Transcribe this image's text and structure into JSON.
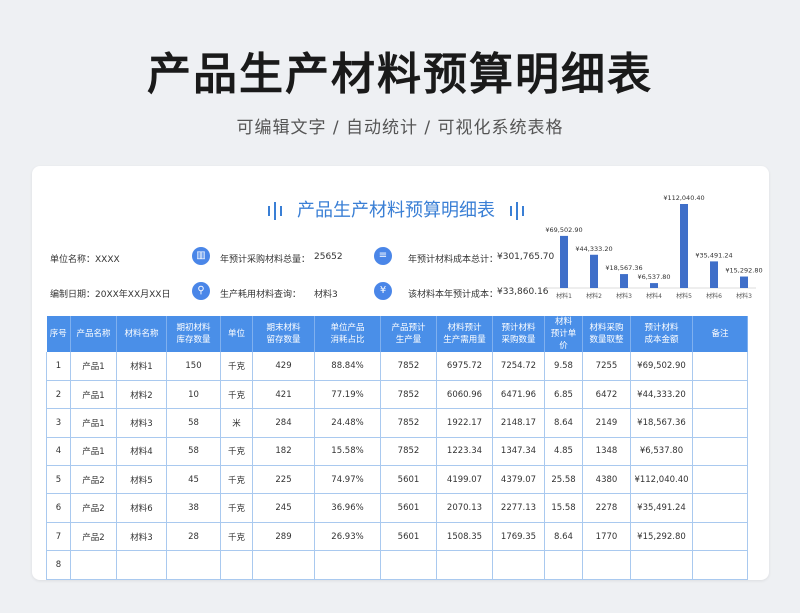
{
  "page": {
    "title": "产品生产材料预算明细表",
    "subtitle": "可编辑文字 / 自动统计 / 可视化系统表格"
  },
  "sheet": {
    "title": "产品生产材料预算明细表",
    "info": {
      "unit_label": "单位名称：XXXX",
      "date_label": "编制日期：20XX年XX月XX日",
      "total_purchase_label": "年预计采购材料总量：",
      "total_purchase_value": "25652",
      "total_cost_label": "年预计材料成本总计：",
      "total_cost_value": "¥301,765.70",
      "query_label": "生产耗用材料查询：",
      "query_value": "材料3",
      "material_cost_label": "该材料本年预计成本：",
      "material_cost_value": "¥33,860.16"
    },
    "headers": [
      [
        "序号"
      ],
      [
        "产品名称"
      ],
      [
        "材料名称"
      ],
      [
        "期初材料",
        "库存数量"
      ],
      [
        "单位"
      ],
      [
        "期末材料",
        "留存数量"
      ],
      [
        "单位产品",
        "消耗占比"
      ],
      [
        "产品预计",
        "生产量"
      ],
      [
        "材料预计",
        "生产需用量"
      ],
      [
        "预计材料",
        "采购数量"
      ],
      [
        "材料",
        "预计单价"
      ],
      [
        "材料采购",
        "数量取整"
      ],
      [
        "预计材料",
        "成本金额"
      ],
      [
        "备注"
      ]
    ],
    "rows": [
      [
        "1",
        "产品1",
        "材料1",
        "150",
        "千克",
        "429",
        "88.84%",
        "7852",
        "6975.72",
        "7254.72",
        "9.58",
        "7255",
        "¥69,502.90",
        ""
      ],
      [
        "2",
        "产品1",
        "材料2",
        "10",
        "千克",
        "421",
        "77.19%",
        "7852",
        "6060.96",
        "6471.96",
        "6.85",
        "6472",
        "¥44,333.20",
        ""
      ],
      [
        "3",
        "产品1",
        "材料3",
        "58",
        "米",
        "284",
        "24.48%",
        "7852",
        "1922.17",
        "2148.17",
        "8.64",
        "2149",
        "¥18,567.36",
        ""
      ],
      [
        "4",
        "产品1",
        "材料4",
        "58",
        "千克",
        "182",
        "15.58%",
        "7852",
        "1223.34",
        "1347.34",
        "4.85",
        "1348",
        "¥6,537.80",
        ""
      ],
      [
        "5",
        "产品2",
        "材料5",
        "45",
        "千克",
        "225",
        "74.97%",
        "5601",
        "4199.07",
        "4379.07",
        "25.58",
        "4380",
        "¥112,040.40",
        ""
      ],
      [
        "6",
        "产品2",
        "材料6",
        "38",
        "千克",
        "245",
        "36.96%",
        "5601",
        "2070.13",
        "2277.13",
        "15.58",
        "2278",
        "¥35,491.24",
        ""
      ],
      [
        "7",
        "产品2",
        "材料3",
        "28",
        "千克",
        "289",
        "26.93%",
        "5601",
        "1508.35",
        "1769.35",
        "8.64",
        "1770",
        "¥15,292.80",
        ""
      ],
      [
        "8",
        "",
        "",
        "",
        "",
        "",
        "",
        "",
        "",
        "",
        "",
        "",
        "",
        ""
      ]
    ]
  },
  "colors": {
    "accent": "#4a8fe8",
    "bar": "#3f6fc9",
    "title_blue": "#3a7fd5"
  },
  "chart_data": {
    "type": "bar",
    "categories": [
      "材料1",
      "材料2",
      "材料3",
      "材料4",
      "材料5",
      "材料6",
      "材料3"
    ],
    "values": [
      69502.9,
      44333.2,
      18567.36,
      6537.8,
      112040.4,
      35491.24,
      15292.8
    ],
    "labels": [
      "¥69,502.90",
      "¥44,333.20",
      "¥18,567.36",
      "¥6,537.80",
      "¥112,040.40",
      "¥35,491.24",
      "¥15,292.80"
    ],
    "title": "",
    "xlabel": "",
    "ylabel": "",
    "ylim": [
      0,
      112040.4
    ]
  }
}
